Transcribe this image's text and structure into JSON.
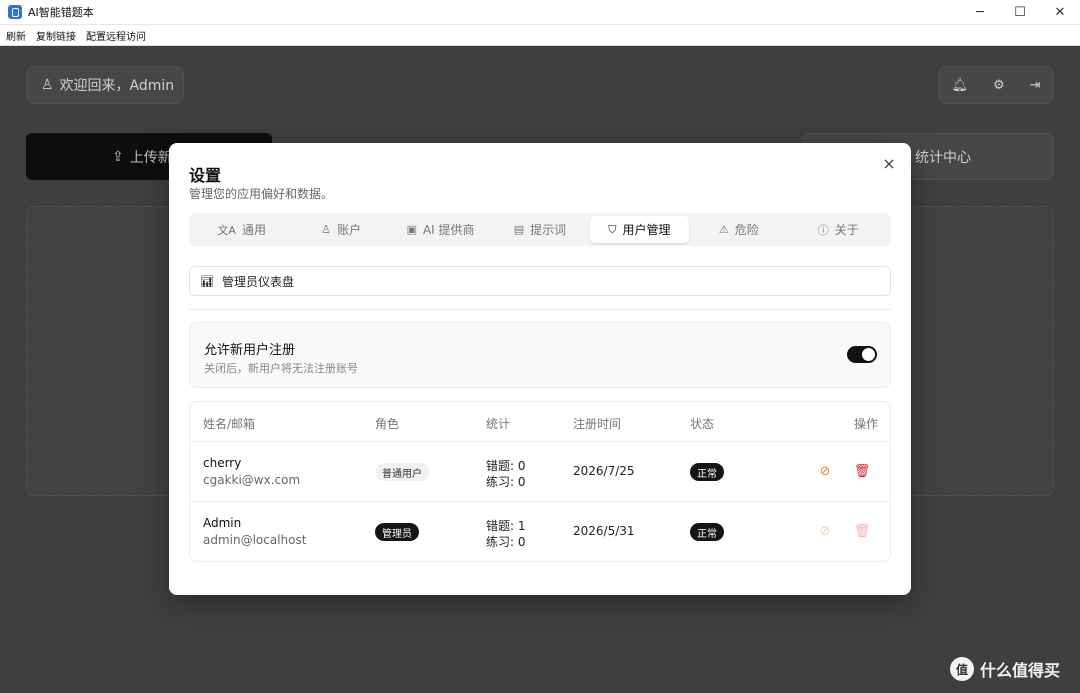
{
  "window": {
    "title": "AI智能错题本",
    "controls": [
      "─",
      "☐",
      "✕"
    ]
  },
  "menu": [
    "刷新",
    "复制链接",
    "配置远程访问"
  ],
  "background": {
    "welcome": "欢迎回来，Admin",
    "upload_label": "上传新",
    "stats_label": "统计中心",
    "top_icons": [
      "bell-icon",
      "gear-icon",
      "logout-icon"
    ]
  },
  "modal": {
    "title": "设置",
    "subtitle": "管理您的应用偏好和数据。",
    "close": "×",
    "tabs": [
      {
        "icon": "文A",
        "label": "通用",
        "active": false
      },
      {
        "icon": "♙",
        "label": "账户",
        "active": false
      },
      {
        "icon": "▣",
        "label": "AI 提供商",
        "active": false
      },
      {
        "icon": "▤",
        "label": "提示词",
        "active": false
      },
      {
        "icon": "⛉",
        "label": "用户管理",
        "active": true
      },
      {
        "icon": "⚠",
        "label": "危险",
        "active": false
      },
      {
        "icon": "ⓘ",
        "label": "关于",
        "active": false
      }
    ],
    "dashboard_button": "管理员仪表盘",
    "registration": {
      "title": "允许新用户注册",
      "desc": "关闭后，新用户将无法注册账号",
      "enabled": true
    },
    "table": {
      "headers": [
        "姓名/邮箱",
        "角色",
        "统计",
        "注册时间",
        "状态",
        "操作"
      ],
      "rows": [
        {
          "name": "cherry",
          "email": "cgakki@wx.com",
          "role": "普通用户",
          "stat_errors": "错题: 0",
          "stat_practice": "练习: 0",
          "registered": "2026/7/25",
          "status": "正常"
        },
        {
          "name": "Admin",
          "email": "admin@localhost",
          "role": "管理员",
          "stat_errors": "错题: 1",
          "stat_practice": "练习: 0",
          "registered": "2026/5/31",
          "status": "正常"
        }
      ]
    }
  },
  "watermark": {
    "logo": "值",
    "text": "什么值得买"
  }
}
